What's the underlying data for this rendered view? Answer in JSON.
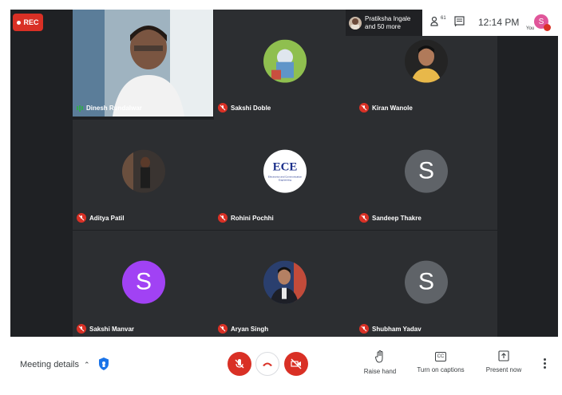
{
  "recording": {
    "label": "REC",
    "color": "#d93025"
  },
  "header": {
    "joiner_name": "Pratiksha Ingale",
    "joiner_more": "and 50 more",
    "participants_count": "61",
    "time": "12:14 PM",
    "self_label": "You",
    "self_initial": "S"
  },
  "participants": [
    {
      "name": "Dinesh Rundalwar",
      "speaking": true
    },
    {
      "name": "Sakshi Doble",
      "muted": true
    },
    {
      "name": "Kiran Wanole",
      "muted": true
    },
    {
      "name": "Aditya Patil",
      "muted": true
    },
    {
      "name": "Rohini Pochhi",
      "muted": true,
      "logo_title": "ECE",
      "logo_subtitle": "Electronics and Communication Engineering"
    },
    {
      "name": "Sandeep Thakre",
      "muted": true,
      "initial": "S",
      "color": "#5f6368"
    },
    {
      "name": "Sakshi Manvar",
      "muted": true,
      "initial": "S",
      "color": "#a142f4"
    },
    {
      "name": "Aryan Singh",
      "muted": true
    },
    {
      "name": "Shubham Yadav",
      "muted": true,
      "initial": "S",
      "color": "#5f6368"
    }
  ],
  "footer": {
    "meeting_details": "Meeting details",
    "raise_hand": "Raise hand",
    "captions": "Turn on captions",
    "present": "Present now",
    "captions_icon_text": "CC"
  },
  "colors": {
    "mute_red": "#d93025",
    "tile_bg": "#2c2e31",
    "stage_bg": "#1f2124",
    "shield_blue": "#1a73e8"
  }
}
